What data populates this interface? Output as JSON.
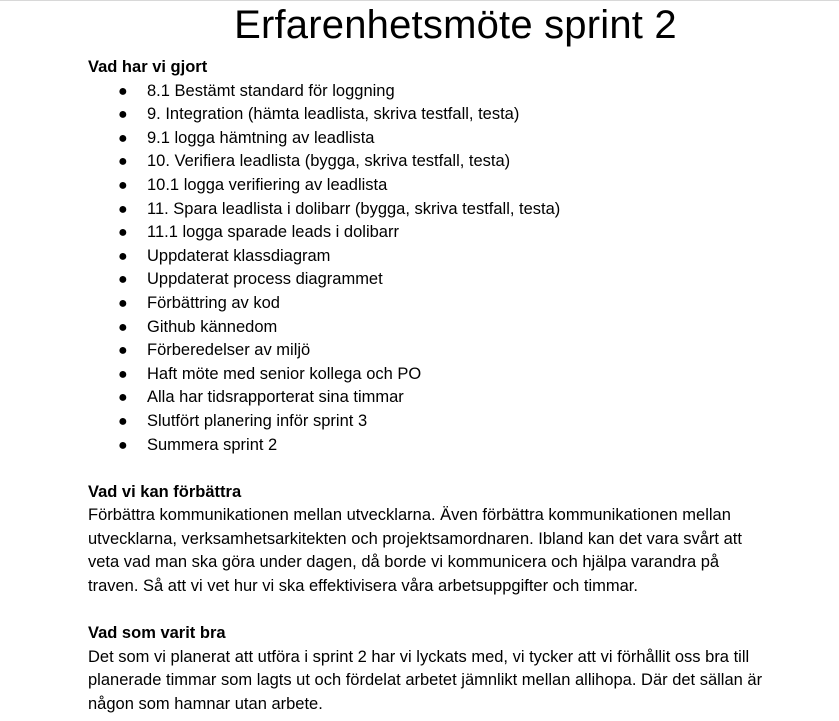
{
  "document": {
    "title": "Erfarenhetsmöte sprint 2",
    "section1": {
      "heading": "Vad har vi gjort",
      "items": [
        "8.1 Bestämt standard för loggning",
        "9. Integration (hämta leadlista, skriva testfall, testa)",
        "9.1 logga hämtning av leadlista",
        "10. Verifiera leadlista (bygga, skriva testfall, testa)",
        "10.1 logga verifiering av leadlista",
        "11. Spara leadlista i dolibarr (bygga, skriva testfall, testa)",
        "11.1 logga sparade leads i dolibarr",
        "Uppdaterat klassdiagram",
        "Uppdaterat process diagrammet",
        "Förbättring av kod",
        "Github kännedom",
        "Förberedelser av miljö",
        "Haft möte med senior kollega och PO",
        "Alla har tidsrapporterat sina timmar",
        "Slutfört planering inför sprint 3",
        "Summera sprint 2"
      ]
    },
    "section2": {
      "heading": "Vad vi kan förbättra",
      "lines": [
        "Förbättra kommunikationen mellan utvecklarna. Även förbättra kommunikationen mellan",
        "utvecklarna, verksamhetsarkitekten och projektsamordnaren. Ibland kan det vara svårt att",
        "veta vad man ska göra under dagen, då borde vi kommunicera och hjälpa varandra på",
        "traven. Så att vi vet hur vi ska effektivisera våra arbetsuppgifter och timmar."
      ]
    },
    "section3": {
      "heading": "Vad som varit bra",
      "lines": [
        "Det som vi planerat att utföra i sprint 2 har vi lyckats med, vi tycker att vi förhållit oss bra till",
        "planerade timmar som lagts ut och fördelat arbetet jämnlikt mellan allihopa. Där det sällan är",
        "någon som hamnar utan arbete."
      ]
    }
  }
}
